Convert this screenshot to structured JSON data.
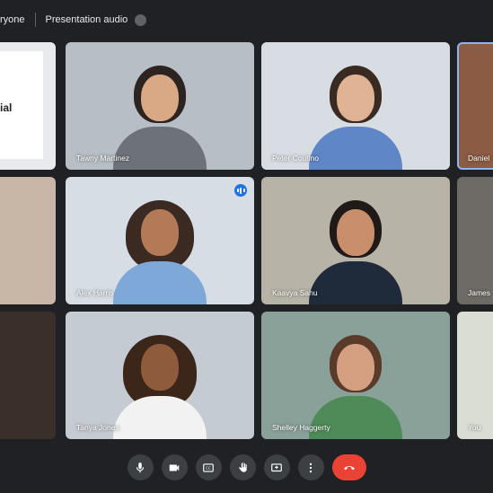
{
  "topbar": {
    "everyone_label": "ryone",
    "audio_label": "Presentation audio"
  },
  "slide": {
    "text": "ial"
  },
  "participants": [
    "Tawny Martinez",
    "Peter Coutino",
    "Daniel",
    "Alex Harris",
    "Kaavya Sahu",
    "James",
    "Tanya Jones",
    "Shelley Haggerty",
    "You"
  ],
  "controls": [
    "mic-icon",
    "camera-icon",
    "captions-icon",
    "raise-hand-icon",
    "present-icon",
    "more-icon",
    "end-call-icon"
  ],
  "colors": {
    "background": "#202124",
    "tile": "#3c4043",
    "accent": "#1a73e8",
    "end_call": "#ea4335",
    "active_outline": "#8ab4f8"
  }
}
